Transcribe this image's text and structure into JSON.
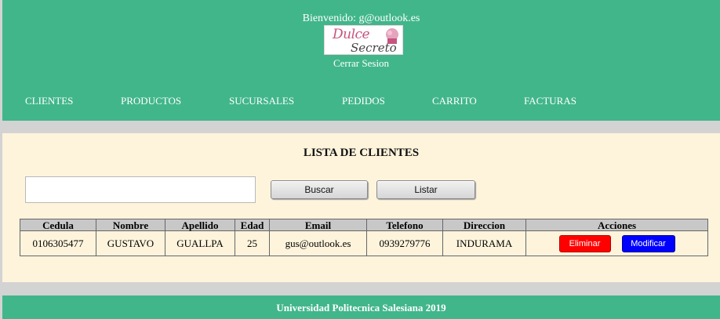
{
  "header": {
    "welcome": "Bienvenido: g@outlook.es",
    "logo": {
      "line1": "Dulce",
      "line2": "Secreto",
      "accent_color": "#c7547e"
    },
    "logout": "Cerrar Sesion",
    "background": "#41b68b"
  },
  "nav": {
    "items": [
      {
        "label": "CLIENTES"
      },
      {
        "label": "PRODUCTOS"
      },
      {
        "label": "SUCURSALES"
      },
      {
        "label": "PEDIDOS"
      },
      {
        "label": "CARRITO"
      },
      {
        "label": "FACTURAS"
      }
    ]
  },
  "main": {
    "title": "LISTA DE CLIENTES",
    "search": {
      "value": "",
      "placeholder": ""
    },
    "search_button": "Buscar",
    "list_button": "Listar",
    "background": "#fef4dc"
  },
  "table": {
    "columns": [
      "Cedula",
      "Nombre",
      "Apellido",
      "Edad",
      "Email",
      "Telefono",
      "Direccion",
      "Acciones"
    ],
    "rows": [
      {
        "cedula": "0106305477",
        "nombre": "GUSTAVO",
        "apellido": "GUALLPA",
        "edad": "25",
        "email": "gus@outlook.es",
        "telefono": "0939279776",
        "direccion": "INDURAMA",
        "delete_label": "Eliminar",
        "modify_label": "Modificar"
      }
    ]
  },
  "colors": {
    "delete": "#ff0000",
    "modify": "#0000ff"
  },
  "footer": {
    "text": "Universidad Politecnica Salesiana 2019"
  }
}
